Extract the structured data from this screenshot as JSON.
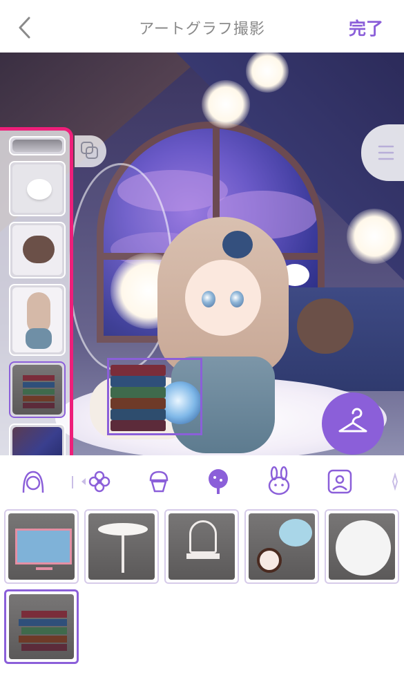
{
  "header": {
    "title": "アートグラフ撮影",
    "done_label": "完了"
  },
  "colors": {
    "accent": "#8b5fd9",
    "highlight_border": "#ee1f7a",
    "title_gray": "#8a8a8a"
  },
  "scene": {
    "layers": [
      {
        "name": "cloud-frame-item",
        "selected": false
      },
      {
        "name": "snow-bird",
        "selected": false
      },
      {
        "name": "brown-dog",
        "selected": false
      },
      {
        "name": "girl-avatar",
        "selected": false
      },
      {
        "name": "book-stack",
        "selected": true
      },
      {
        "name": "attic-background",
        "selected": false
      }
    ]
  },
  "category_tabs": [
    {
      "icon": "avatar-face-icon",
      "selected": false
    },
    {
      "icon": "flower-icon",
      "selected": false
    },
    {
      "icon": "cupcake-icon",
      "selected": false
    },
    {
      "icon": "tree-icon",
      "selected": true
    },
    {
      "icon": "rabbit-icon",
      "selected": false
    },
    {
      "icon": "photo-frame-icon",
      "selected": false
    }
  ],
  "items": [
    {
      "name": "tv-weather-report",
      "selected": false
    },
    {
      "name": "white-round-table",
      "selected": false
    },
    {
      "name": "white-ornate-chair",
      "selected": false
    },
    {
      "name": "tea-and-cake-set",
      "selected": false
    },
    {
      "name": "white-round-rug",
      "selected": false
    },
    {
      "name": "book-stack",
      "selected": true
    }
  ]
}
